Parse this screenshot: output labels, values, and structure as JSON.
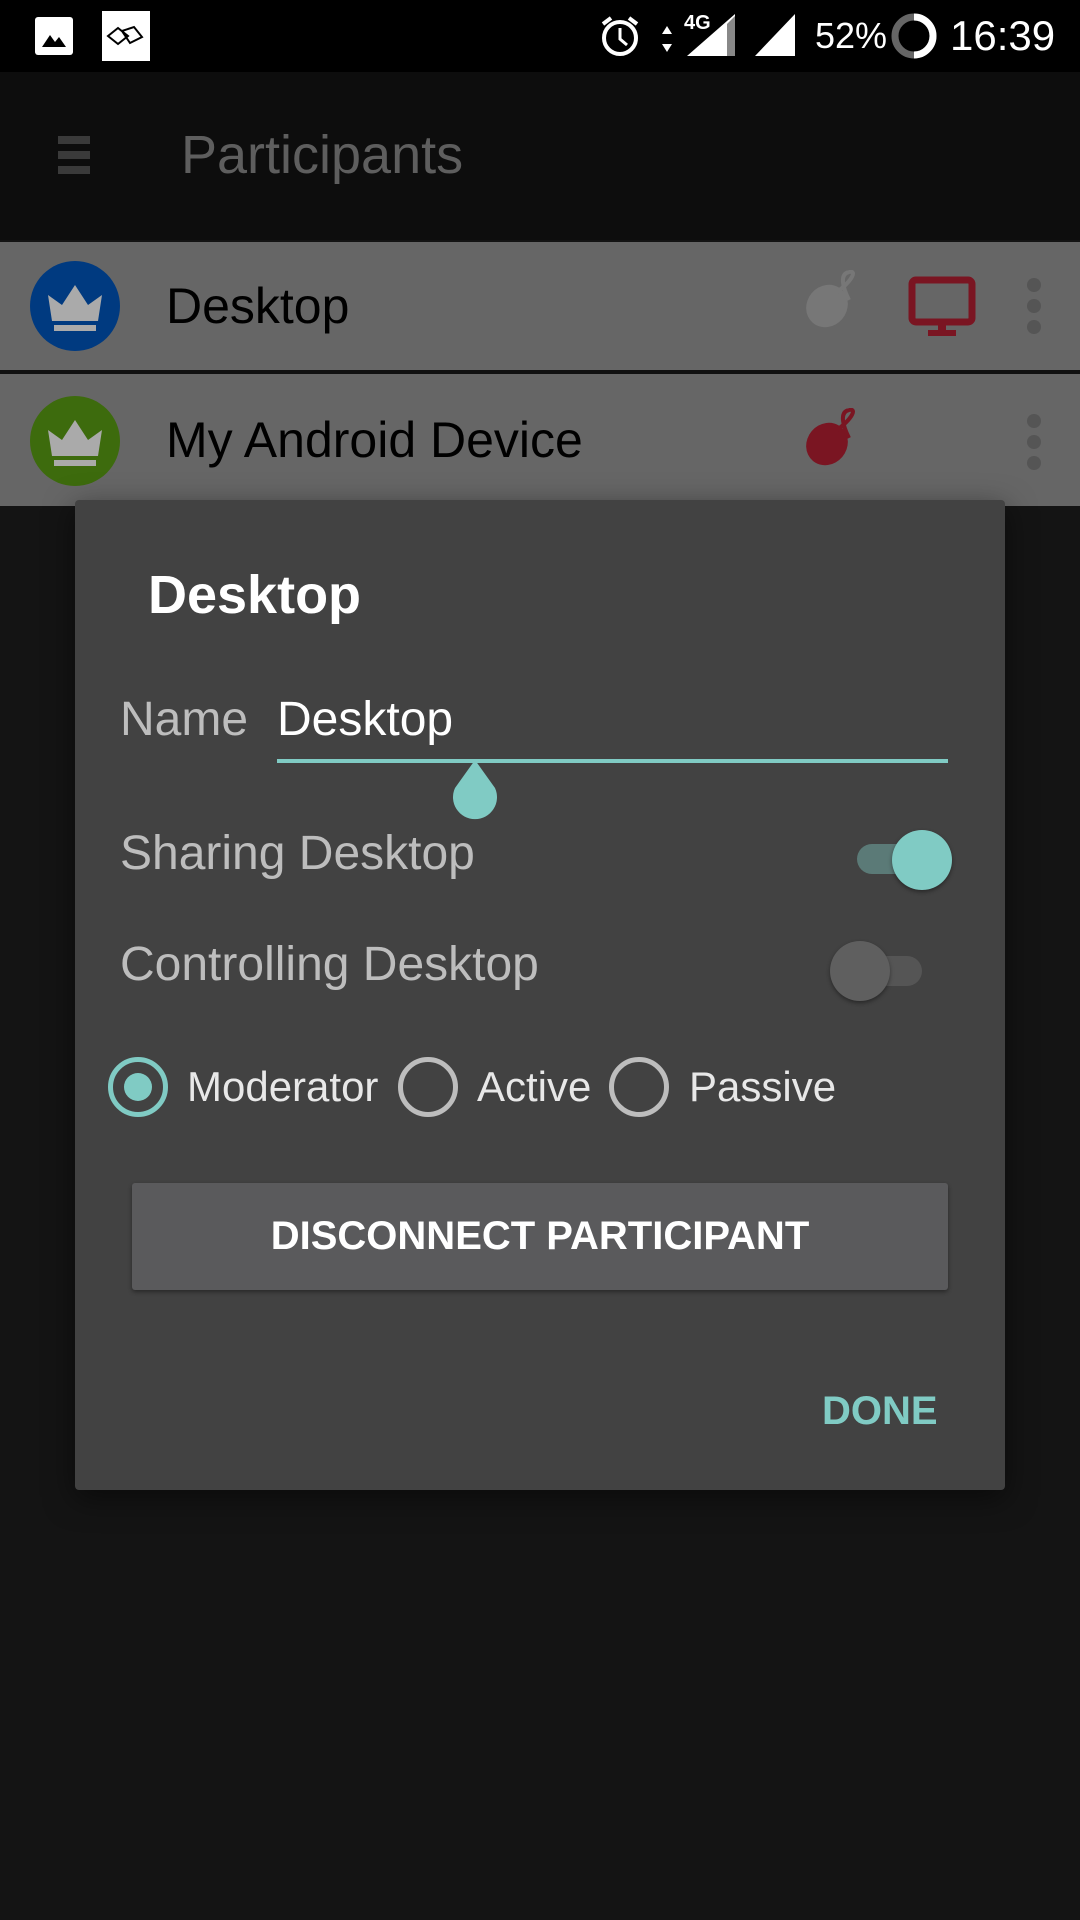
{
  "status_bar": {
    "battery": "52%",
    "time": "16:39",
    "network": "4G",
    "icons": [
      "gallery-icon",
      "cast-icon",
      "alarm-icon",
      "data-arrows-icon",
      "signal-icon",
      "battery-icon"
    ]
  },
  "app_bar": {
    "title": "Participants",
    "menu_icon": "hamburger-icon"
  },
  "participants": [
    {
      "name": "Desktop",
      "avatar_color": "#003a80",
      "icons": [
        "mouse-icon",
        "monitor-icon"
      ],
      "mouse_color": "#777777",
      "monitor_color": "#7a1522"
    },
    {
      "name": "My Android Device",
      "avatar_color": "#3d6b0d",
      "icons": [
        "mouse-icon"
      ],
      "mouse_color": "#7a1522"
    }
  ],
  "dialog": {
    "title": "Desktop",
    "name_label": "Name",
    "name_value": "Desktop",
    "sharing_label": "Sharing Desktop",
    "sharing_on": true,
    "controlling_label": "Controlling Desktop",
    "controlling_on": false,
    "roles": [
      {
        "label": "Moderator",
        "selected": true
      },
      {
        "label": "Active",
        "selected": false
      },
      {
        "label": "Passive",
        "selected": false
      }
    ],
    "disconnect_label": "DISCONNECT PARTICIPANT",
    "done_label": "DONE",
    "accent": "#80cbc4"
  }
}
